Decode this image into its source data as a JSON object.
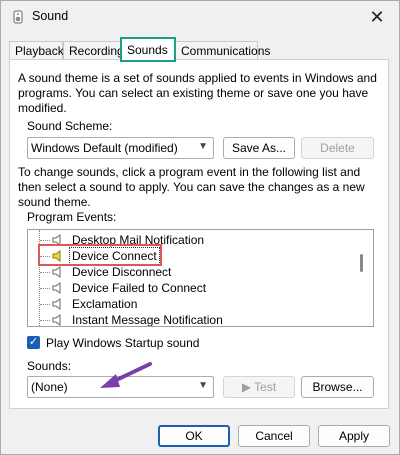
{
  "window": {
    "title": "Sound"
  },
  "tabs": [
    {
      "label": "Playback"
    },
    {
      "label": "Recording"
    },
    {
      "label": "Sounds"
    },
    {
      "label": "Communications"
    }
  ],
  "sounds": {
    "description": "A sound theme is a set of sounds applied to events in Windows and programs. You can select an existing theme or save one you have modified.",
    "scheme_label": "Sound Scheme:",
    "scheme_value": "Windows Default (modified)",
    "save_as_label": "Save As...",
    "delete_label": "Delete",
    "instructions": "To change sounds, click a program event in the following list and then select a sound to apply. You can save the changes as a new sound theme.",
    "events_label": "Program Events:",
    "events": [
      "Desktop Mail Notification",
      "Device Connect",
      "Device Disconnect",
      "Device Failed to Connect",
      "Exclamation",
      "Instant Message Notification"
    ],
    "startup_label": "Play Windows Startup sound",
    "sounds_label": "Sounds:",
    "sound_value": "(None)",
    "test_label": "Test",
    "browse_label": "Browse..."
  },
  "footer": {
    "ok": "OK",
    "cancel": "Cancel",
    "apply": "Apply"
  },
  "colors": {
    "active_tab_outline": "#1a9f8b",
    "highlight": "#e05555",
    "annotation_arrow": "#7b3fa8",
    "checkbox": "#1a5fb4"
  }
}
